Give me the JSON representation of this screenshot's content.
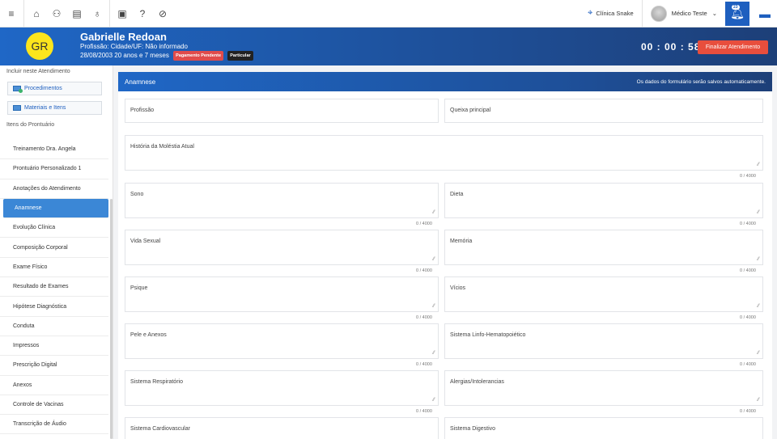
{
  "topbar": {
    "clinic": "Clínica Snake",
    "user": "Médico Teste",
    "notifications": "23"
  },
  "patient": {
    "initials": "GR",
    "name": "Gabrielle Redoan",
    "profession_line": "Profissão:  Cidade/UF: Não informado",
    "dob_line": "28/08/2003  20 anos e 7 meses",
    "badge_payment": "Pagamento Pendente",
    "badge_type": "Particular",
    "timer": "00 : 00 : 58",
    "finalize_label": "Finalizar Atendimento"
  },
  "sidebar": {
    "include_label": "Incluir neste Atendimento",
    "procedures": "Procedimentos",
    "materials": "Materiais e Itens",
    "items_label": "Itens do Prontuário",
    "items": [
      "Treinamento Dra. Angela",
      "Prontuário Personalizado 1",
      "Anotações do Atendimento",
      "Anamnese",
      "Evolução Clínica",
      "Composição Corporal",
      "Exame Físico",
      "Resultado de Exames",
      "Hipótese Diagnóstica",
      "Conduta",
      "Impressos",
      "Prescrição Digital",
      "Anexos",
      "Controle de Vacinas",
      "Transcrição de Áudio"
    ]
  },
  "main": {
    "title": "Anamnese",
    "autosave_note": "Os dados do formulário serão salvos automaticamente.",
    "counter": "0 / 4000",
    "fields": {
      "profissao": "Profissão",
      "queixa": "Queixa principal",
      "historia": "História da Moléstia Atual",
      "sono": "Sono",
      "dieta": "Dieta",
      "vida_sexual": "Vida Sexual",
      "memoria": "Memória",
      "psique": "Psique",
      "vicios": "Vícios",
      "pele": "Pele e Anexos",
      "linfo": "Sistema Linfo-Hematopoiético",
      "respiratorio": "Sistema Respiratório",
      "alergias": "Alergias/Intolerancias",
      "cardio": "Sistema Cardiovascular",
      "digestivo": "Sistema Digestivo"
    }
  }
}
